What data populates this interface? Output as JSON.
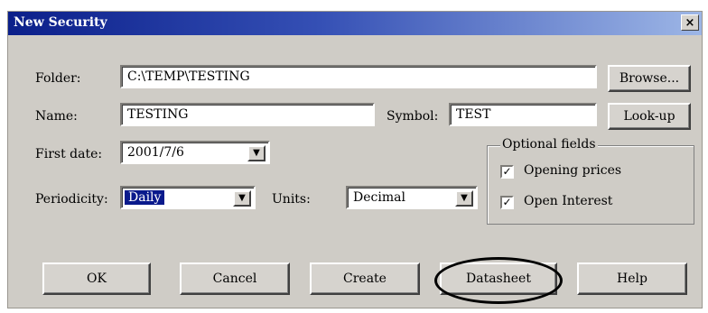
{
  "window": {
    "title": "New Security",
    "close_glyph": "×"
  },
  "folder": {
    "label": "Folder:",
    "value": "C:\\TEMP\\TESTING",
    "browse_label": "Browse..."
  },
  "name": {
    "label": "Name:",
    "value": "TESTING"
  },
  "symbol": {
    "label": "Symbol:",
    "value": "TEST",
    "lookup_label": "Look-up"
  },
  "first_date": {
    "label": "First date:",
    "value": "2001/7/6"
  },
  "periodicity": {
    "label": "Periodicity:",
    "value": "Daily"
  },
  "units": {
    "label": "Units:",
    "value": "Decimal"
  },
  "optional_fields": {
    "title": "Optional fields",
    "items": [
      {
        "label": "Opening prices",
        "checked": true
      },
      {
        "label": "Open Interest",
        "checked": true
      }
    ]
  },
  "buttons": {
    "ok": "OK",
    "cancel": "Cancel",
    "create": "Create",
    "datasheet": "Datasheet",
    "help": "Help"
  },
  "check_glyph": "✓",
  "dropdown_glyph": "▼"
}
